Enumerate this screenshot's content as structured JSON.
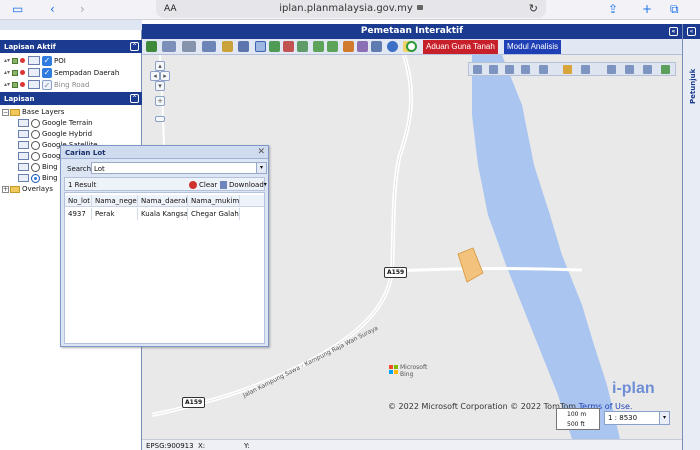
{
  "browser": {
    "text_size_label": "AA",
    "url": "iplan.planmalaysia.gov.my"
  },
  "left_panel": {
    "active_layers_title": "Lapisan Aktif",
    "active_layers": [
      {
        "label": "POI",
        "checked": true
      },
      {
        "label": "Sempadan Daerah",
        "checked": true
      },
      {
        "label": "Bing Road",
        "checked": false
      }
    ],
    "layers_title": "Lapisan",
    "base_layers_label": "Base Layers",
    "base_layers": [
      {
        "label": "Google Terrain",
        "selected": false
      },
      {
        "label": "Google Hybrid",
        "selected": false
      },
      {
        "label": "Google Satellite",
        "selected": false
      },
      {
        "label": "Google",
        "selected": false
      },
      {
        "label": "Bing A",
        "selected": false
      },
      {
        "label": "Bing R",
        "selected": true
      }
    ],
    "overlays_label": "Overlays"
  },
  "main": {
    "title": "Pemetaan Interaktif",
    "aduan_button": "Aduan Guna Tanah",
    "modul_button": "Modul Analisis"
  },
  "right_panel": {
    "label": "Petunjuk"
  },
  "map": {
    "road_shield_1": "A159",
    "road_shield_2": "A159",
    "road_label": "Jalan Kampung Sawa - Kampung Raja Wan Suraya",
    "bing_logo_line1": "Microsoft",
    "bing_logo_line2": "Bing",
    "attribution": "© 2022 Microsoft Corporation © 2022 TomTom",
    "terms_link": "Terms of Use.",
    "watermark": "i-plan",
    "scale_top": "100 m",
    "scale_bottom": "500 ft",
    "scale_value": "1 : 8530"
  },
  "dialog": {
    "title": "Carian Lot",
    "search_label": "Search:",
    "search_value": "Lot",
    "result_count": "1 Result",
    "clear_label": "Clear",
    "download_label": "Download",
    "columns": [
      "No_lot",
      "Nama_negeri",
      "Nama_daerah",
      "Nama_mukim"
    ],
    "rows": [
      [
        "4937",
        "Perak",
        "Kuala Kangsar",
        "Chegar Galah"
      ]
    ]
  },
  "status_bar": {
    "epsg": "EPSG:900913",
    "x_label": "X:",
    "y_label": "Y:"
  },
  "colors": {
    "header_blue": "#1a3b8f",
    "river_blue": "#a9c5f0",
    "lot_orange": "#f3c27c",
    "aduan_red": "#c8202a",
    "modul_blue": "#1f3fb5"
  }
}
